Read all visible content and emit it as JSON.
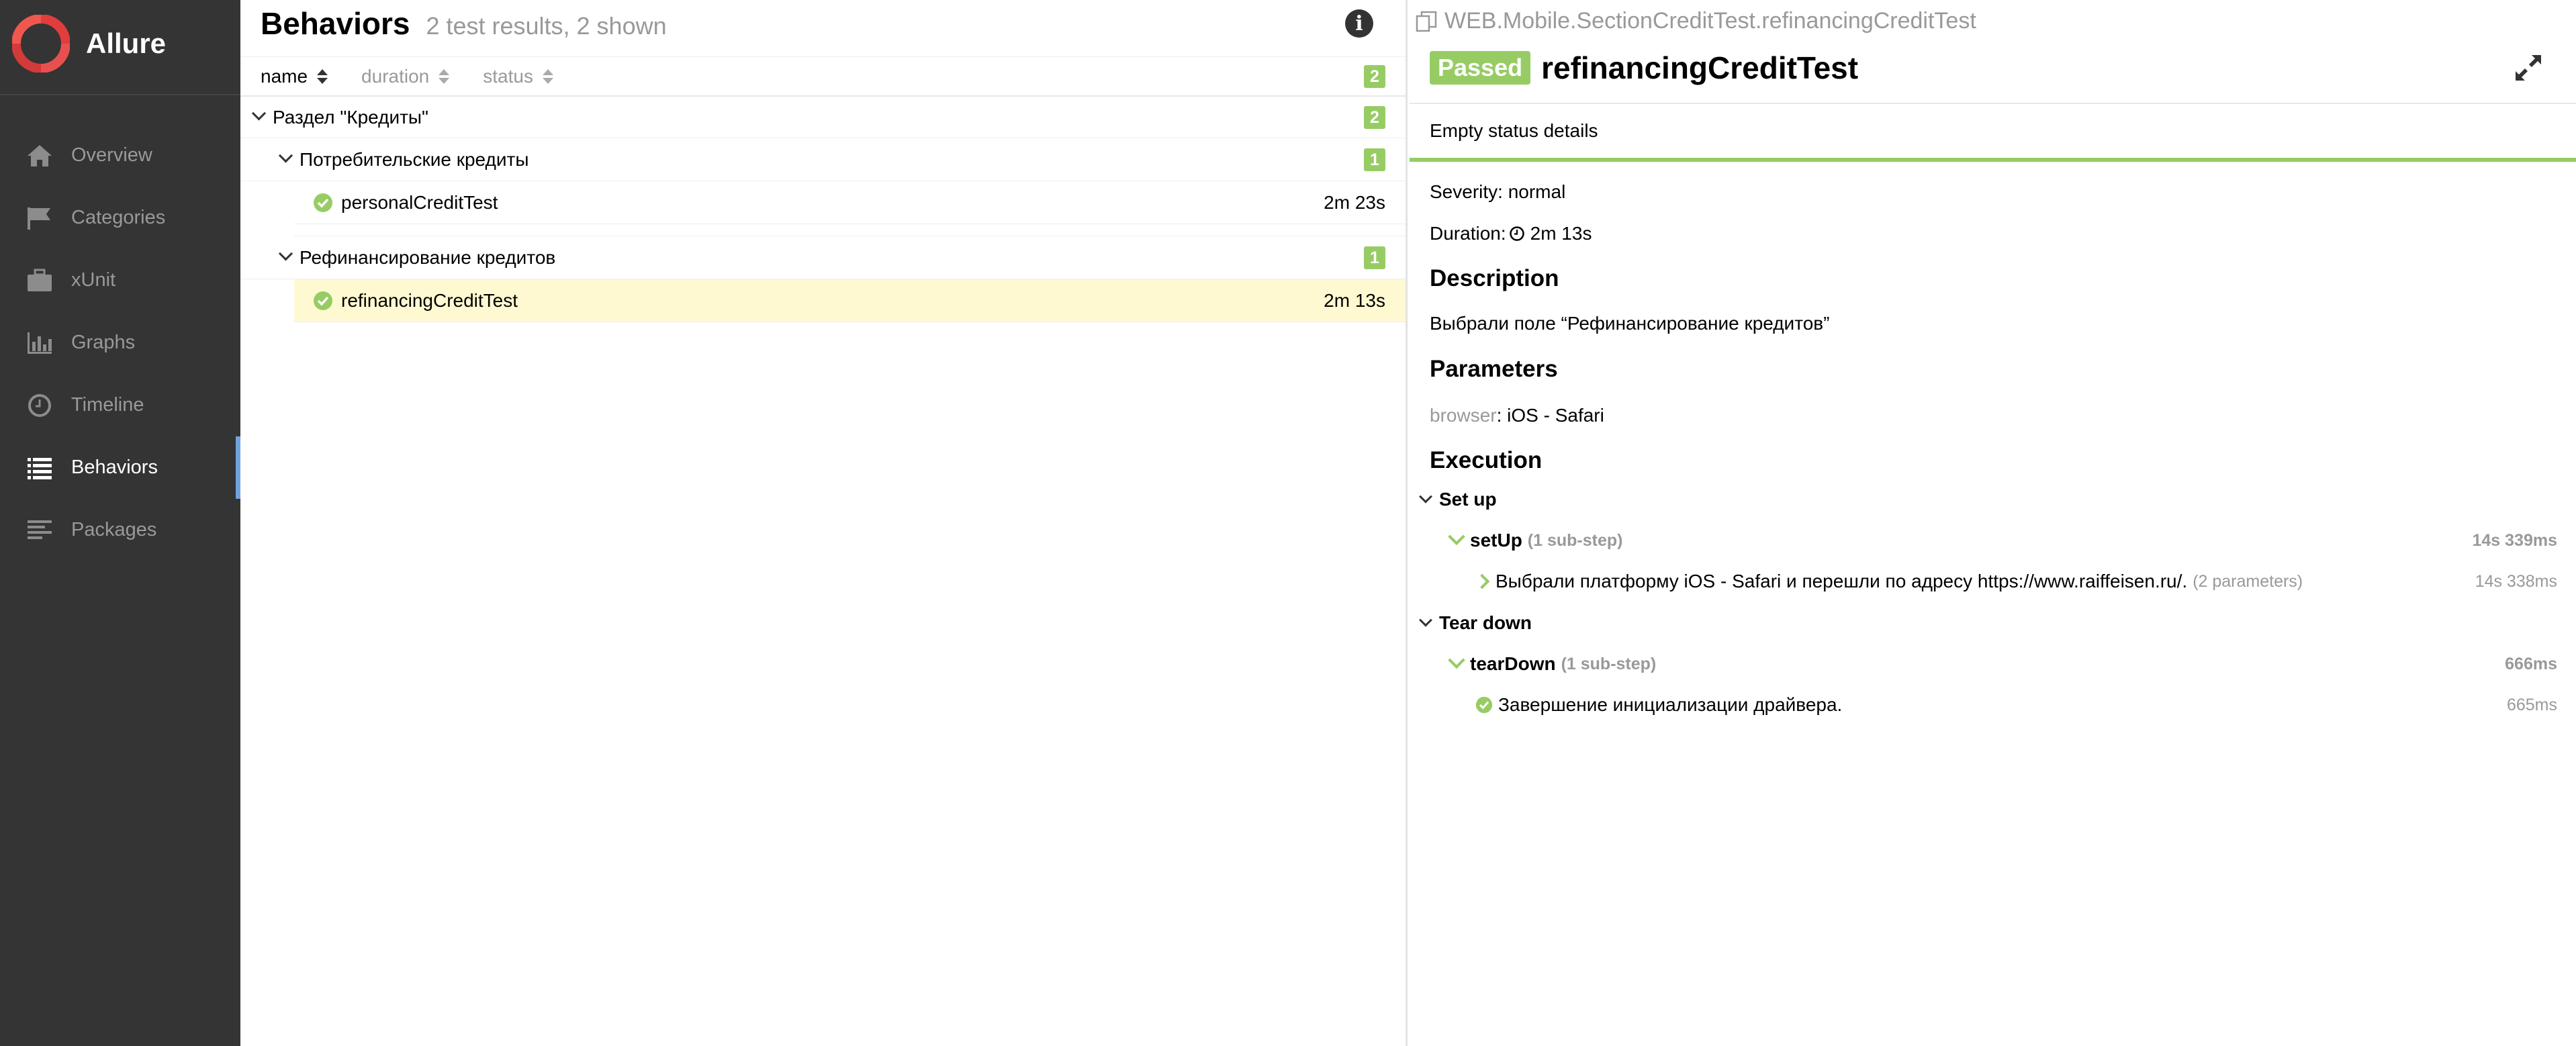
{
  "app": {
    "name": "Allure"
  },
  "sidebar": {
    "items": [
      {
        "label": "Overview",
        "icon": "home-icon",
        "active": false
      },
      {
        "label": "Categories",
        "icon": "flag-icon",
        "active": false
      },
      {
        "label": "xUnit",
        "icon": "briefcase-icon",
        "active": false
      },
      {
        "label": "Graphs",
        "icon": "bar-chart-icon",
        "active": false
      },
      {
        "label": "Timeline",
        "icon": "clock-icon",
        "active": false
      },
      {
        "label": "Behaviors",
        "icon": "list-icon",
        "active": true
      },
      {
        "label": "Packages",
        "icon": "align-left-icon",
        "active": false
      }
    ]
  },
  "behaviors": {
    "title": "Behaviors",
    "subtitle": "2 test results, 2 shown",
    "sort": {
      "name": "name",
      "duration": "duration",
      "status": "status",
      "total": "2"
    },
    "tree": {
      "group": {
        "name": "Раздел \"Кредиты\"",
        "count": "2"
      },
      "subgroups": [
        {
          "name": "Потребительские кредиты",
          "count": "1",
          "test": {
            "name": "personalCreditTest",
            "duration": "2m 23s"
          }
        },
        {
          "name": "Рефинансирование кредитов",
          "count": "1",
          "test": {
            "name": "refinancingCreditTest",
            "duration": "2m 13s"
          }
        }
      ]
    }
  },
  "detail": {
    "path": "WEB.Mobile.SectionCreditTest.refinancingCreditTest",
    "status": "Passed",
    "name": "refinancingCreditTest",
    "status_details": "Empty status details",
    "severity": "Severity: normal",
    "duration_label": "Duration:",
    "duration_value": "2m 13s",
    "description_title": "Description",
    "description": "Выбрали поле “Рефинансирование кредитов”",
    "parameters_title": "Parameters",
    "param_key": "browser",
    "param_value": ": iOS - Safari",
    "execution_title": "Execution",
    "setup": {
      "title": "Set up",
      "step": "setUp",
      "substeps": "(1 sub-step)",
      "time": "14s 339ms",
      "child": "Выбрали платформу iOS - Safari и перешли по адресу https://www.raiffeisen.ru/.",
      "child_params": "(2 parameters)",
      "child_time": "14s 338ms"
    },
    "teardown": {
      "title": "Tear down",
      "step": "tearDown",
      "substeps": "(1 sub-step)",
      "time": "666ms",
      "child": "Завершение инициализации драйвера.",
      "child_time": "665ms"
    }
  },
  "colors": {
    "sidebar": "#343434",
    "passed": "#97cc64",
    "active_marker": "#6fa4dc",
    "selected_row": "#fff9d1"
  }
}
